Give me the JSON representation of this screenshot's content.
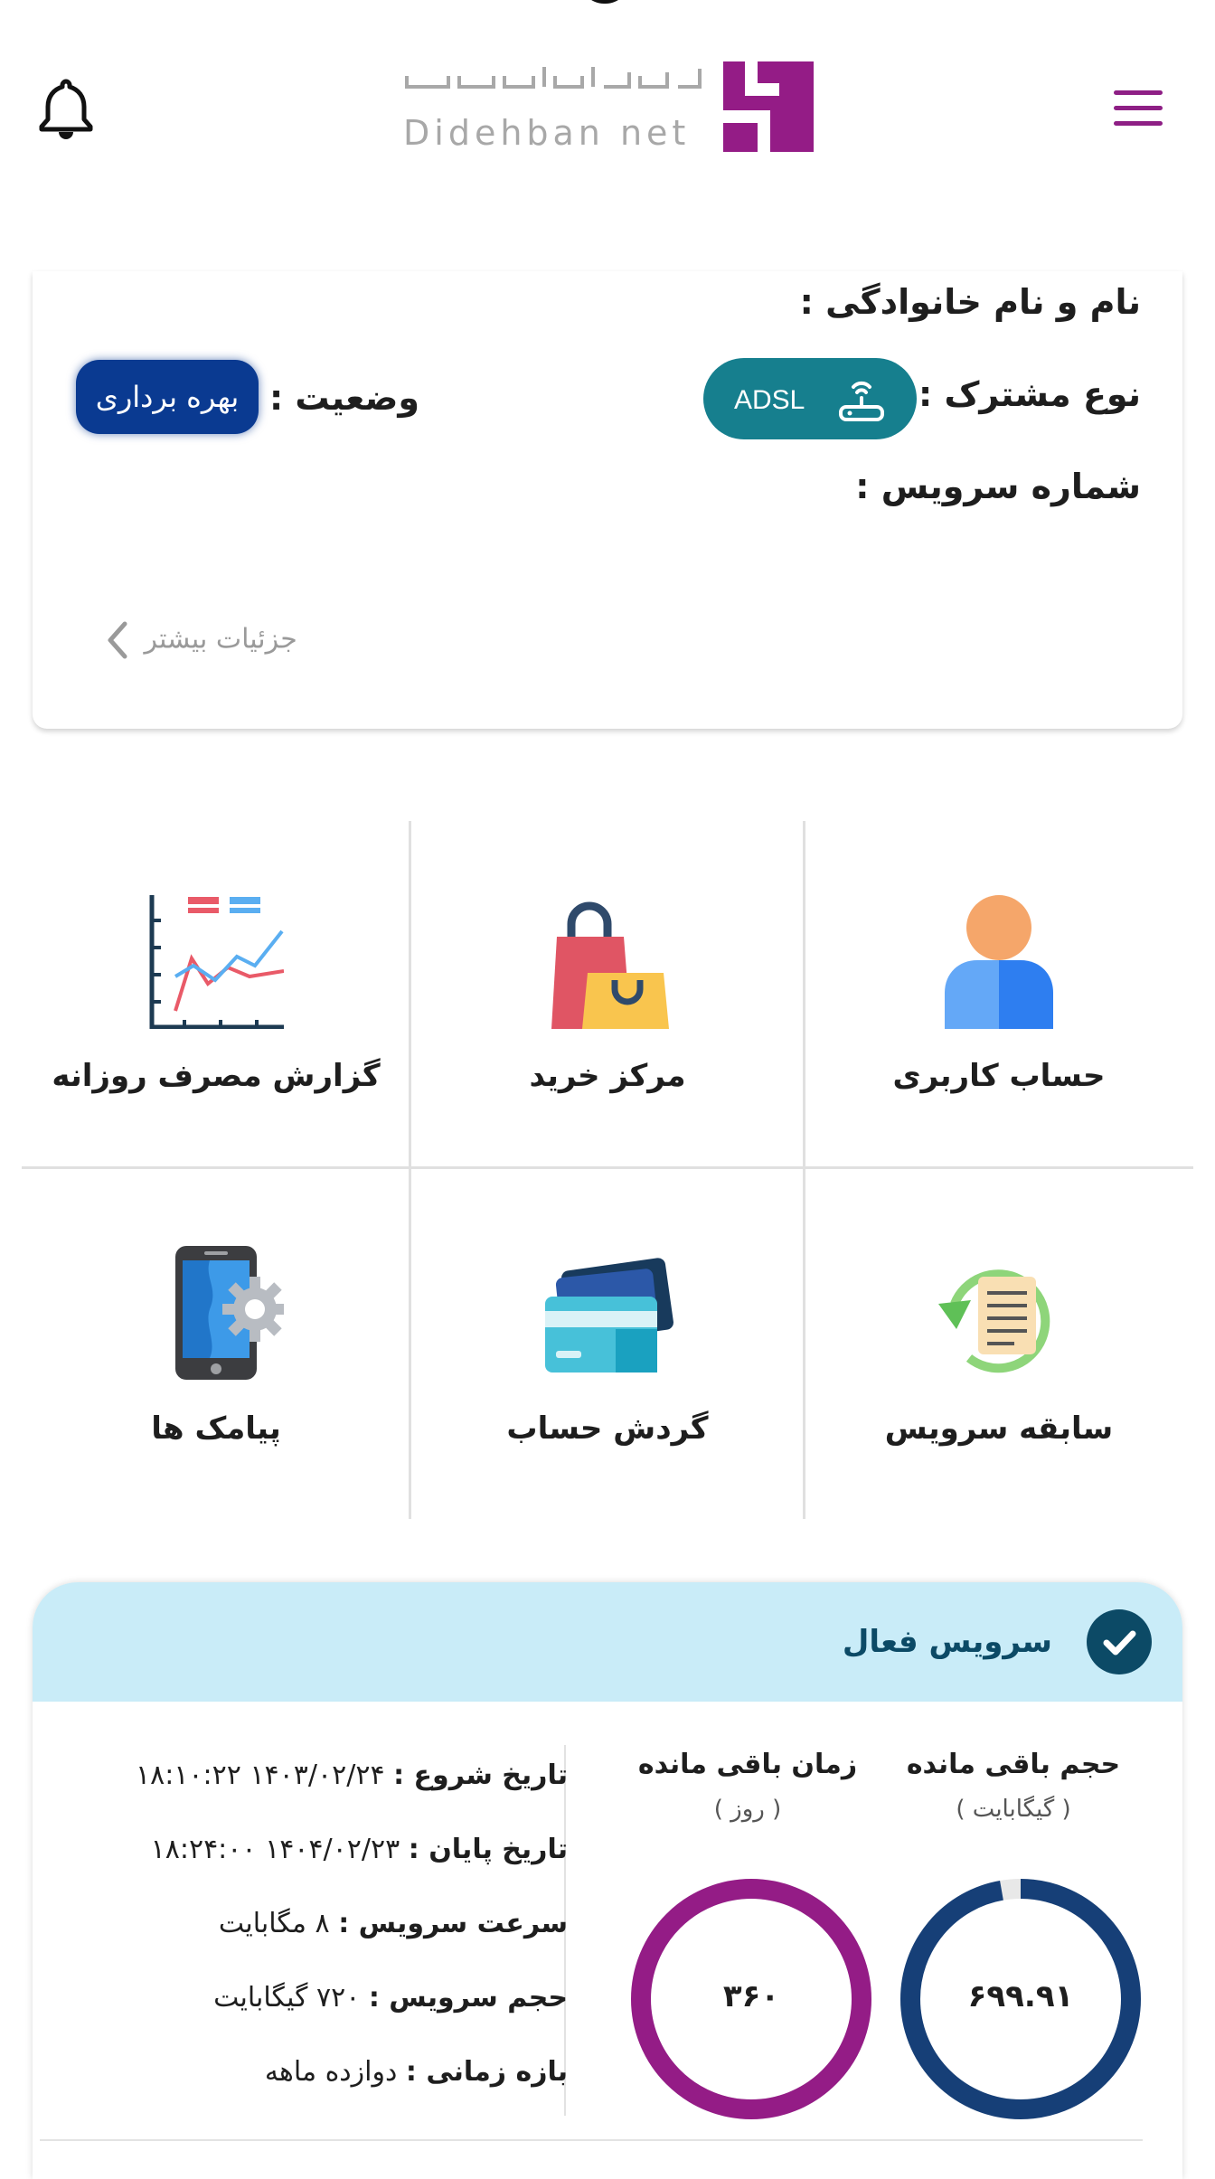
{
  "header": {
    "logo_script": "دیده بان نت",
    "logo_text": "Didehban net",
    "colors": {
      "brand": "#8e1f85",
      "menu_icon": "#8e1f85"
    }
  },
  "subscriber": {
    "name_label": "نام و نام خانوادگی :",
    "type_label": "نوع مشترک :",
    "type_value": "ADSL",
    "status_label": "وضعیت :",
    "status_value": "بهره برداری",
    "service_number_label": "شماره سرویس :",
    "more_details": "جزئیات بیشتر",
    "colors": {
      "adsl_pill": "#167f8e",
      "status_badge": "#0a3a91"
    }
  },
  "menu": {
    "items": [
      {
        "label": "حساب کاربری",
        "icon": "user-icon"
      },
      {
        "label": "مرکز خرید",
        "icon": "shopping-bag-icon"
      },
      {
        "label": "گزارش مصرف روزانه",
        "icon": "line-chart-icon"
      },
      {
        "label": "سابقه سرویس",
        "icon": "history-icon"
      },
      {
        "label": "گردش حساب",
        "icon": "cards-icon"
      },
      {
        "label": "پیامک ها",
        "icon": "phone-settings-icon"
      }
    ]
  },
  "active_service": {
    "title": "سرویس فعال",
    "start_date_label": "تاریخ شروع :",
    "start_date": "۱۴۰۳/۰۲/۲۴ ۱۸:۱۰:۲۲",
    "end_date_label": "تاریخ پایان :",
    "end_date": "۱۴۰۴/۰۲/۲۳ ۱۸:۲۴:۰۰",
    "speed_label": "سرعت سرویس :",
    "speed": "۸ مگابایت",
    "volume_label": "حجم سرویس :",
    "volume": "۷۲۰ گیگابایت",
    "period_label": "بازه زمانی :",
    "period": "دوازده ماهه",
    "remaining_time": {
      "title": "زمان باقی مانده",
      "unit": "( روز )",
      "value": "۳۶۰",
      "fraction": 1.0,
      "color": "#941c86"
    },
    "remaining_volume": {
      "title": "حجم باقی مانده",
      "unit": "( گیگابایت )",
      "value": "۶۹۹.۹۱",
      "fraction": 0.972,
      "color": "#163f77"
    },
    "colors": {
      "header_bg": "#c9ecf8",
      "title": "#0c4a66"
    }
  }
}
